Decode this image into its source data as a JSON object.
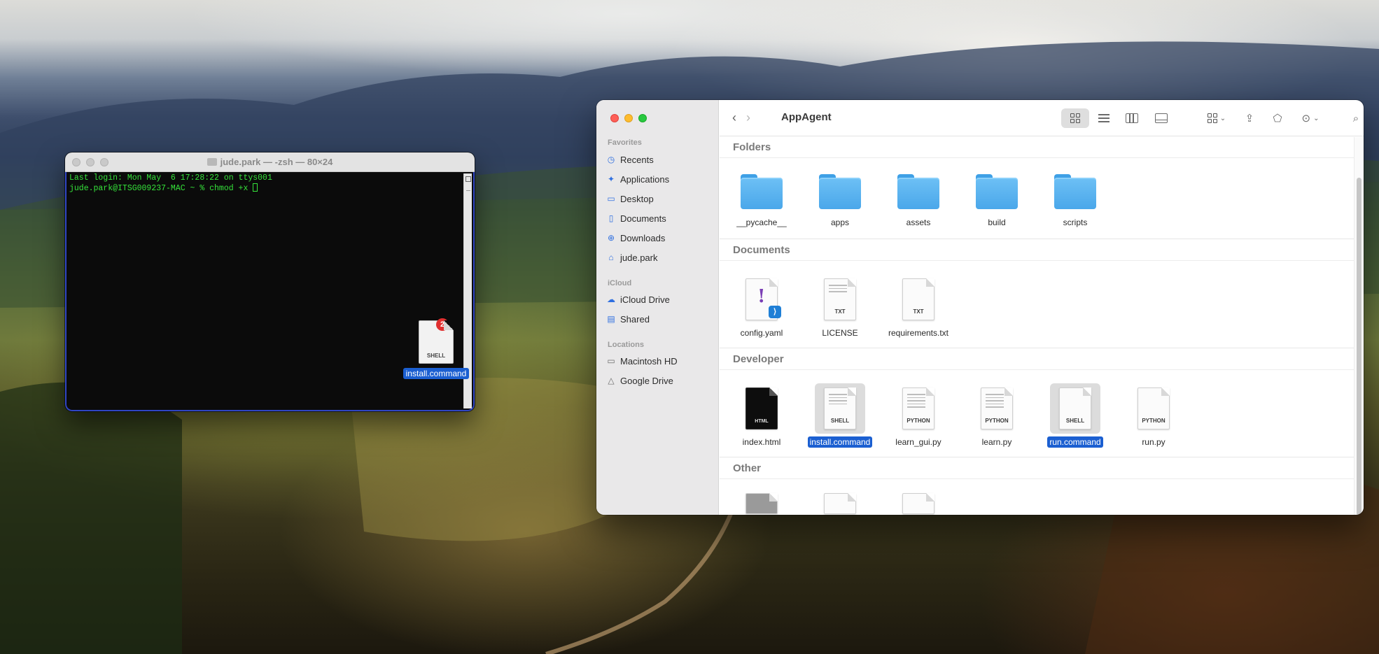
{
  "terminal": {
    "title": "jude.park — -zsh — 80×24",
    "lines": [
      "Last login: Mon May  6 17:28:22 on ttys001",
      "jude.park@ITSG009237-MAC ~ % chmod +x "
    ]
  },
  "drag": {
    "badge_count": "2",
    "kind": "SHELL",
    "label": "install.command"
  },
  "finder": {
    "window_title": "AppAgent",
    "sidebar": {
      "favorites_heading": "Favorites",
      "favorites": [
        {
          "label": "Recents",
          "icon": "clock-icon"
        },
        {
          "label": "Applications",
          "icon": "applications-icon"
        },
        {
          "label": "Desktop",
          "icon": "desktop-icon"
        },
        {
          "label": "Documents",
          "icon": "document-icon"
        },
        {
          "label": "Downloads",
          "icon": "download-icon"
        },
        {
          "label": "jude.park",
          "icon": "home-icon"
        }
      ],
      "icloud_heading": "iCloud",
      "icloud": [
        {
          "label": "iCloud Drive",
          "icon": "cloud-icon"
        },
        {
          "label": "Shared",
          "icon": "shared-folder-icon"
        }
      ],
      "locations_heading": "Locations",
      "locations": [
        {
          "label": "Macintosh HD",
          "icon": "hard-drive-icon"
        },
        {
          "label": "Google Drive",
          "icon": "google-drive-icon"
        }
      ]
    },
    "groups": {
      "folders": {
        "title": "Folders",
        "items": [
          "__pycache__",
          "apps",
          "assets",
          "build",
          "scripts"
        ]
      },
      "documents": {
        "title": "Documents",
        "items": [
          {
            "name": "config.yaml",
            "kind": ""
          },
          {
            "name": "LICENSE",
            "kind": "TXT"
          },
          {
            "name": "requirements.txt",
            "kind": "TXT"
          }
        ]
      },
      "developer": {
        "title": "Developer",
        "items": [
          {
            "name": "index.html",
            "kind": "HTML",
            "selected": false
          },
          {
            "name": "install.command",
            "kind": "SHELL",
            "selected": true
          },
          {
            "name": "learn_gui.py",
            "kind": "PYTHON",
            "selected": false
          },
          {
            "name": "learn.py",
            "kind": "PYTHON",
            "selected": false
          },
          {
            "name": "run.command",
            "kind": "SHELL",
            "selected": true
          },
          {
            "name": "run.py",
            "kind": "PYTHON",
            "selected": false
          }
        ]
      },
      "other": {
        "title": "Other"
      }
    }
  },
  "colors": {
    "selection": "#1b5fd1",
    "terminal_text": "#35e33a",
    "folder_blue": "#4aa7ea"
  }
}
